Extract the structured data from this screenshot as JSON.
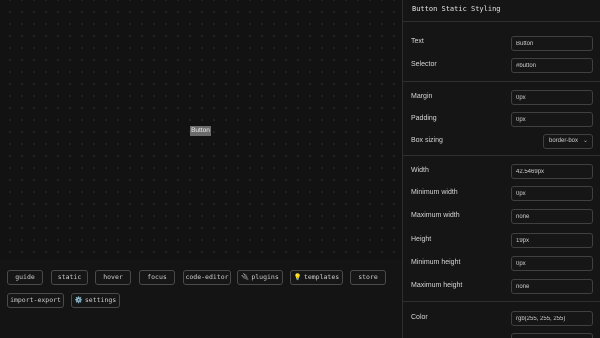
{
  "preview": {
    "button_text": "Button"
  },
  "toolbar": {
    "buttons": [
      {
        "label": "guide",
        "icon": ""
      },
      {
        "label": "static",
        "icon": ""
      },
      {
        "label": "hover",
        "icon": ""
      },
      {
        "label": "focus",
        "icon": ""
      },
      {
        "label": "code-editor",
        "icon": ""
      },
      {
        "label": "plugins",
        "icon": "🔌"
      },
      {
        "label": "templates",
        "icon": "💡"
      },
      {
        "label": "store",
        "icon": ""
      },
      {
        "label": "import-export",
        "icon": ""
      },
      {
        "label": "settings",
        "icon": "⚙️"
      }
    ]
  },
  "panel": {
    "title": "Button Static Styling",
    "fields": {
      "text": {
        "label": "Text",
        "value": "Button"
      },
      "selector": {
        "label": "Selector",
        "value": "#button"
      },
      "margin": {
        "label": "Margin",
        "value": "0px"
      },
      "padding": {
        "label": "Padding",
        "value": "0px"
      },
      "box_sizing": {
        "label": "Box sizing",
        "value": "border-box"
      },
      "width": {
        "label": "Width",
        "value": "42.5469px"
      },
      "min_width": {
        "label": "Minimum width",
        "value": "0px"
      },
      "max_width": {
        "label": "Maximum width",
        "value": "none"
      },
      "height": {
        "label": "Height",
        "value": "19px"
      },
      "min_height": {
        "label": "Minimum height",
        "value": "0px"
      },
      "max_height": {
        "label": "Maximum height",
        "value": "none"
      },
      "color": {
        "label": "Color",
        "value": "rgb(255, 255, 255)"
      }
    }
  }
}
